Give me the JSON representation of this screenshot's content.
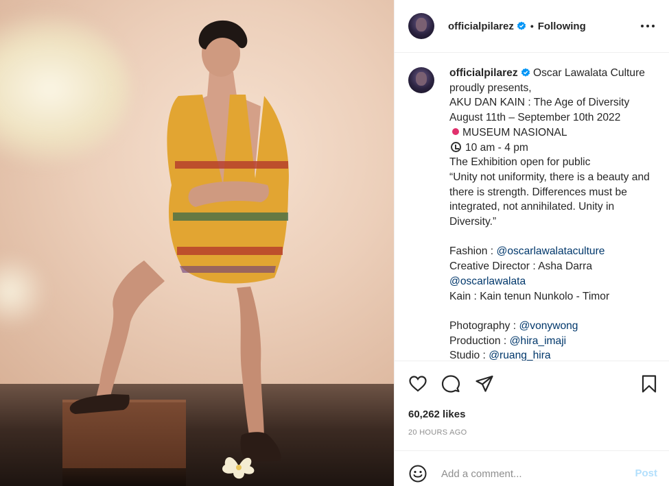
{
  "post": {
    "username": "officialpilarez",
    "dot": "•",
    "follow_status": "Following",
    "more_label": "•••"
  },
  "caption": {
    "username": "officialpilarez",
    "lines": [
      " Oscar Lawalata Culture proudly presents,",
      "AKU DAN KAIN : The Age of Diversity",
      "August 11th – September 10th 2022"
    ],
    "location": "MUSEUM NASIONAL",
    "hours": "10 am - 4 pm",
    "body": "The Exhibition open for public\n“Unity not uniformity, there is a beauty and there is strength. Differences must be integrated, not annihilated. Unity in Diversity.”\n\n",
    "fashion_label": "Fashion : ",
    "fashion_link": "@oscarlawalataculture",
    "creative_director": "\nCreative Director : Asha Darra\n",
    "cd_link": "@oscarlawalata",
    "kain": "\nKain : Kain tenun Nunkolo - Timor\n\n",
    "photo_label": "Photography : ",
    "photo_link": "@vonywong",
    "prod_label": "\nProduction : ",
    "prod_link": "@hira_imaji",
    "studio_label": "\nStudio : ",
    "studio_link": "@ruang_hira"
  },
  "icons": [
    "heart-icon",
    "comment-icon",
    "share-icon",
    "bookmark-icon"
  ],
  "stats": {
    "likes": "60,262 likes",
    "time": "20 HOURS AGO"
  },
  "comment": {
    "placeholder": "Add a comment...",
    "post_label": "Post"
  },
  "colors": {
    "link": "#00376b",
    "verified": "#0095f6",
    "post_disabled": "#b2dffc",
    "meta": "#8e8e8e"
  }
}
